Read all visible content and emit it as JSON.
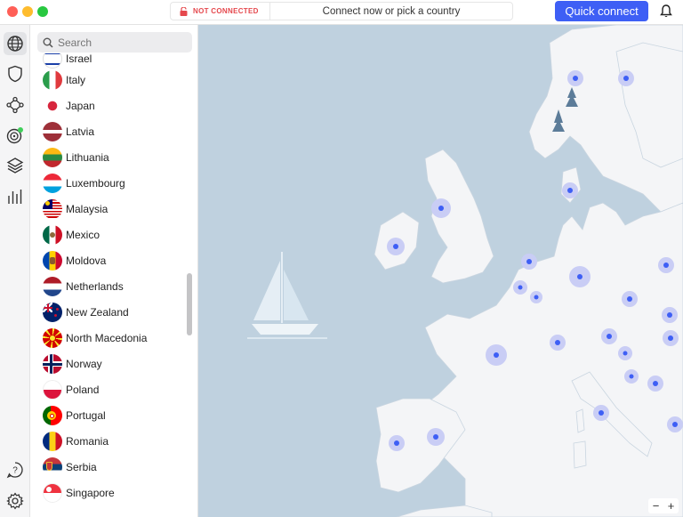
{
  "titlebar": {
    "status_label": "NOT CONNECTED",
    "prompt": "Connect now or pick a country",
    "quick_connect_label": "Quick connect"
  },
  "rail": {
    "icons": [
      "globe-icon",
      "shield-icon",
      "meshnet-icon",
      "target-icon",
      "layers-icon",
      "stats-icon",
      "help-icon",
      "settings-icon"
    ]
  },
  "search": {
    "placeholder": "Search"
  },
  "countries": [
    {
      "name": "Israel"
    },
    {
      "name": "Italy"
    },
    {
      "name": "Japan"
    },
    {
      "name": "Latvia"
    },
    {
      "name": "Lithuania"
    },
    {
      "name": "Luxembourg"
    },
    {
      "name": "Malaysia"
    },
    {
      "name": "Mexico"
    },
    {
      "name": "Moldova"
    },
    {
      "name": "Netherlands"
    },
    {
      "name": "New Zealand"
    },
    {
      "name": "North Macedonia"
    },
    {
      "name": "Norway"
    },
    {
      "name": "Poland"
    },
    {
      "name": "Portugal"
    },
    {
      "name": "Romania"
    },
    {
      "name": "Serbia"
    },
    {
      "name": "Singapore"
    }
  ],
  "colors": {
    "accent": "#3e5ff5",
    "danger": "#e5484d",
    "sea": "#bfd1df",
    "land": "#f4f5f7",
    "marker": "#3e5ff5"
  },
  "map": {
    "zoom_out": "−",
    "zoom_in": "+"
  }
}
